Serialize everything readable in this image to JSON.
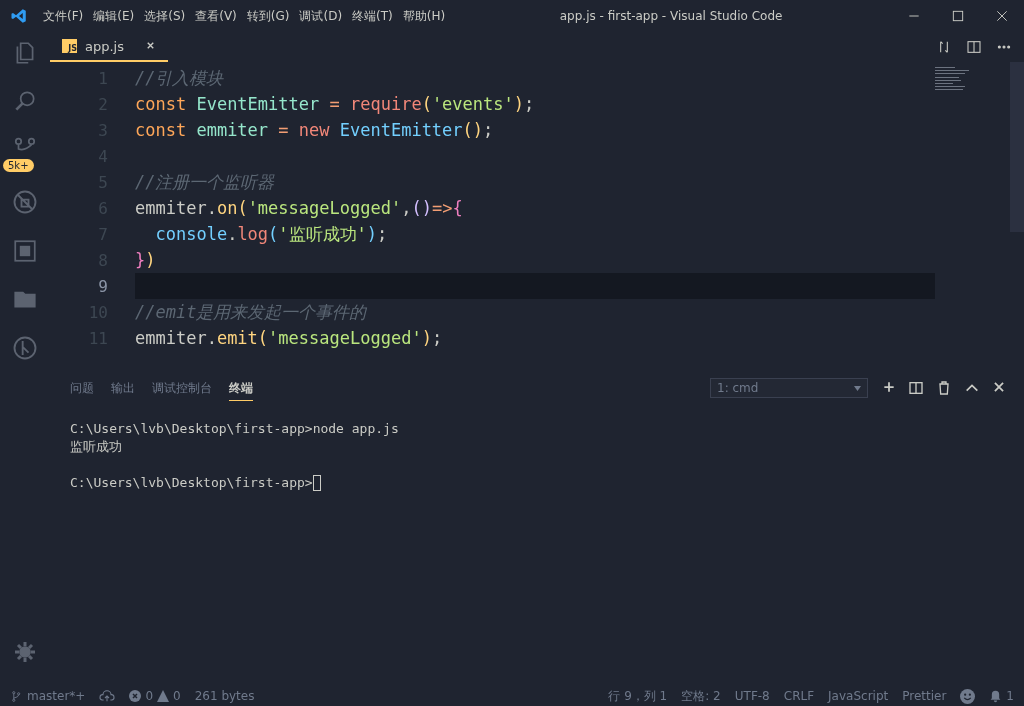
{
  "window": {
    "title": "app.js - first-app - Visual Studio Code"
  },
  "menu": [
    "文件(F)",
    "编辑(E)",
    "选择(S)",
    "查看(V)",
    "转到(G)",
    "调试(D)",
    "终端(T)",
    "帮助(H)"
  ],
  "activity_bar": {
    "source_control_badge": "5k+"
  },
  "tabs": [
    {
      "label": "app.js",
      "badge": "JS",
      "selected": true
    }
  ],
  "editor": {
    "lines": [
      {
        "number": "1",
        "current": false,
        "tokens": [
          {
            "text": "//引入模块",
            "kind": "comment"
          }
        ]
      },
      {
        "number": "2",
        "current": false,
        "tokens": [
          {
            "text": "const ",
            "kind": "keyword"
          },
          {
            "text": "EventEmitter",
            "kind": "variable"
          },
          {
            "text": " = ",
            "kind": "operator"
          },
          {
            "text": "require",
            "kind": "call"
          },
          {
            "text": "(",
            "kind": "paren"
          },
          {
            "text": "'events'",
            "kind": "string"
          },
          {
            "text": ")",
            "kind": "paren"
          },
          {
            "text": ";",
            "kind": "plain"
          }
        ]
      },
      {
        "number": "3",
        "current": false,
        "tokens": [
          {
            "text": "const ",
            "kind": "keyword"
          },
          {
            "text": "emmiter",
            "kind": "variable"
          },
          {
            "text": " = ",
            "kind": "operator"
          },
          {
            "text": "new ",
            "kind": "call"
          },
          {
            "text": "EventEmitter",
            "kind": "class"
          },
          {
            "text": "()",
            "kind": "paren"
          },
          {
            "text": ";",
            "kind": "plain"
          }
        ]
      },
      {
        "number": "4",
        "current": false
      },
      {
        "number": "5",
        "current": false,
        "tokens": [
          {
            "text": "//注册一个监听器",
            "kind": "comment"
          }
        ]
      },
      {
        "number": "6",
        "current": false,
        "tokens": [
          {
            "text": "emmiter.",
            "kind": "plain"
          },
          {
            "text": "on",
            "kind": "method"
          },
          {
            "text": "(",
            "kind": "paren"
          },
          {
            "text": "'messageLogged'",
            "kind": "string"
          },
          {
            "text": ",",
            "kind": "plain"
          },
          {
            "text": "()",
            "kind": "paren2"
          },
          {
            "text": "=>",
            "kind": "operator"
          },
          {
            "text": "{",
            "kind": "paren3"
          }
        ]
      },
      {
        "number": "7",
        "current": false,
        "tokens": [
          {
            "text": "  console",
            "kind": "class"
          },
          {
            "text": ".",
            "kind": "plain"
          },
          {
            "text": "log",
            "kind": "call"
          },
          {
            "text": "(",
            "kind": "paren4"
          },
          {
            "text": "'监听成功'",
            "kind": "string"
          },
          {
            "text": ")",
            "kind": "paren4"
          },
          {
            "text": ";",
            "kind": "plain"
          }
        ]
      },
      {
        "number": "8",
        "current": false,
        "tokens": [
          {
            "text": "}",
            "kind": "paren3"
          },
          {
            "text": ")",
            "kind": "paren"
          }
        ]
      },
      {
        "number": "9",
        "current": true
      },
      {
        "number": "10",
        "current": false,
        "tokens": [
          {
            "text": "//emit是用来发起一个事件的",
            "kind": "comment"
          }
        ]
      },
      {
        "number": "11",
        "current": false,
        "tokens": [
          {
            "text": "emmiter.",
            "kind": "plain"
          },
          {
            "text": "emit",
            "kind": "method"
          },
          {
            "text": "(",
            "kind": "paren"
          },
          {
            "text": "'messageLogged'",
            "kind": "string"
          },
          {
            "text": ")",
            "kind": "paren"
          },
          {
            "text": ";",
            "kind": "plain"
          }
        ]
      }
    ]
  },
  "panel": {
    "tabs": [
      {
        "label": "问题",
        "selected": false
      },
      {
        "label": "输出",
        "selected": false
      },
      {
        "label": "调试控制台",
        "selected": false
      },
      {
        "label": "终端",
        "selected": true
      }
    ],
    "terminal_select": "1: cmd",
    "terminal_blocks": [
      [
        "C:\\Users\\lvb\\Desktop\\first-app>node app.js",
        "监听成功"
      ],
      [
        "C:\\Users\\lvb\\Desktop\\first-app>"
      ]
    ]
  },
  "status_bar": {
    "branch": "master*+",
    "errors": "0",
    "warnings": "0",
    "size": "261 bytes",
    "position": "行 9，列 1",
    "indent": "空格: 2",
    "encoding": "UTF-8",
    "eol": "CRLF",
    "language": "JavaScript",
    "formatter": "Prettier",
    "notifications": "1"
  }
}
